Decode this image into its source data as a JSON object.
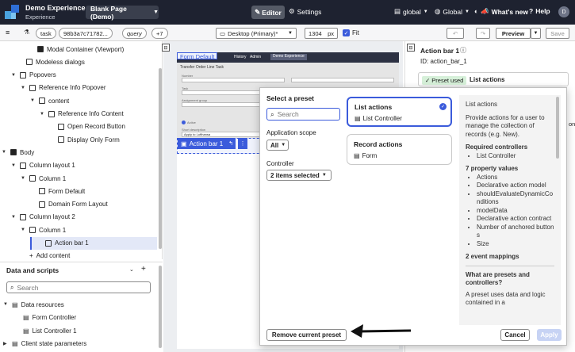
{
  "topbar": {
    "app_title": "Demo Experience",
    "app_subtitle": "Experience",
    "page_select": "Blank Page (Demo)",
    "editor_tab": "Editor",
    "settings_tab": "Settings",
    "scope1": "global",
    "scope2": "Global",
    "whats_new": "What's new",
    "help": "Help",
    "user_initial": "D"
  },
  "toolbar": {
    "menu_icon": "≡",
    "chip_task": "task",
    "chip_id": "98b3a7c71782...",
    "chip_query": "query",
    "chip_more": "+7",
    "device": "Desktop (Primary)*",
    "width_value": "1304",
    "width_unit": "px",
    "fit_label": "Fit",
    "preview": "Preview",
    "save": "Save"
  },
  "tree": [
    {
      "label": "Modal Container (Viewport)",
      "indent": 36,
      "twisty": "",
      "icon": "solid"
    },
    {
      "label": "Modeless dialogs",
      "indent": 22,
      "twisty": "",
      "icon": "box"
    },
    {
      "label": "Popovers",
      "indent": 14,
      "twisty": "▼",
      "icon": "box"
    },
    {
      "label": "Reference Info Popover",
      "indent": 26,
      "twisty": "▼",
      "icon": "box"
    },
    {
      "label": "content",
      "indent": 38,
      "twisty": "▼",
      "icon": "box"
    },
    {
      "label": "Reference Info Content",
      "indent": 50,
      "twisty": "▼",
      "icon": "box"
    },
    {
      "label": "Open Record Button",
      "indent": 62,
      "twisty": "",
      "icon": "box"
    },
    {
      "label": "Display Only Form",
      "indent": 62,
      "twisty": "",
      "icon": "box"
    },
    {
      "label": "Body",
      "indent": 2,
      "twisty": "▼",
      "icon": "solid"
    },
    {
      "label": "Column layout 1",
      "indent": 14,
      "twisty": "▼",
      "icon": "box"
    },
    {
      "label": "Column 1",
      "indent": 26,
      "twisty": "▼",
      "icon": "box"
    },
    {
      "label": "Form Default",
      "indent": 38,
      "twisty": "",
      "icon": "box"
    },
    {
      "label": "Domain Form Layout",
      "indent": 38,
      "twisty": "",
      "icon": "box"
    },
    {
      "label": "Column layout 2",
      "indent": 14,
      "twisty": "▼",
      "icon": "box"
    },
    {
      "label": "Column 1",
      "indent": 26,
      "twisty": "▼",
      "icon": "box"
    },
    {
      "label": "Action bar 1",
      "indent": 38,
      "twisty": "",
      "icon": "box"
    },
    {
      "label": "Add content",
      "indent": 26,
      "twisty": "",
      "icon": "plus"
    }
  ],
  "data_scripts": {
    "title": "Data and scripts",
    "search_placeholder": "Search",
    "items": [
      {
        "label": "Data resources",
        "twisty": "▼",
        "indent": 4
      },
      {
        "label": "Form Controller",
        "twisty": "",
        "indent": 18
      },
      {
        "label": "List Controller 1",
        "twisty": "",
        "indent": 18
      },
      {
        "label": "Client state parameters",
        "twisty": "▶",
        "indent": 4
      }
    ]
  },
  "canvas": {
    "form_default_label": "Form Default",
    "form_title": "Transfer Order Line Task",
    "nav_items": [
      "History",
      "Admin",
      "Demo Experience"
    ],
    "field_labels": [
      "Number",
      "Task",
      "Assignment group",
      "Active",
      "Assignment group (rel)",
      "Short description"
    ],
    "field_value": "Apply to Lufthansa",
    "action_bar_label": "Action bar 1"
  },
  "right": {
    "title": "Action bar 1",
    "id_label": "ID: action_bar_1",
    "preset_used": "Preset used",
    "preset_name": "List actions",
    "stub_text": "on"
  },
  "modal": {
    "select_title": "Select a preset",
    "search_placeholder": "Search",
    "app_scope_label": "Application scope",
    "app_scope_value": "All",
    "controller_label": "Controller",
    "controller_value": "2 items selected",
    "cards": [
      {
        "title": "List actions",
        "sub": "List Controller",
        "selected": true
      },
      {
        "title": "Record actions",
        "sub": "Form",
        "selected": false
      }
    ],
    "info": {
      "title": "List actions",
      "desc": "Provide actions for a user to manage the collection of records (e.g. New).",
      "req_title": "Required controllers",
      "req_items": [
        "List Controller"
      ],
      "prop_title": "7 property values",
      "props": [
        "Actions",
        "Declarative action model",
        "shouldEvaluateDynamicConditions",
        "modelData",
        "Declarative action contract",
        "Number of anchored buttons",
        "Size"
      ],
      "event_title": "2 event mappings",
      "what_title": "What are presets and controllers?",
      "what_desc": "A preset uses data and logic contained in a"
    },
    "remove_btn": "Remove current preset",
    "cancel_btn": "Cancel",
    "apply_btn": "Apply"
  },
  "colors": {
    "topbar": "#1e2230",
    "accent": "#3b5bdb",
    "selected_row": "#e3e8f7",
    "canvas_bg": "#eceef1"
  }
}
